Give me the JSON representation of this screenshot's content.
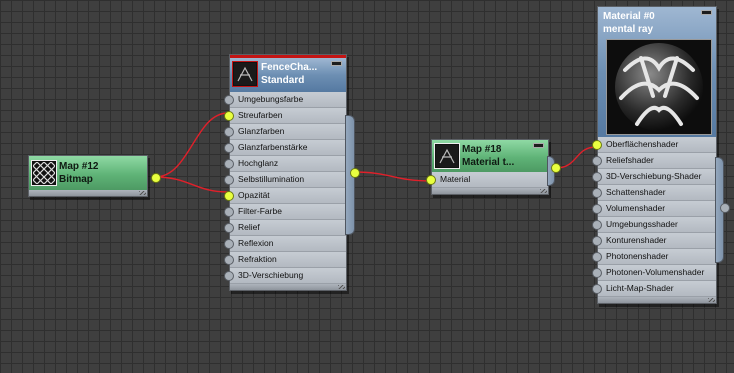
{
  "nodes": {
    "bitmap": {
      "line1": "Map #12",
      "line2": "Bitmap",
      "icon": "chainlink-fence-thumbnail"
    },
    "fence": {
      "line1": "FenceCha...",
      "line2": "Standard",
      "icon": "fence-material-thumbnail",
      "slots": [
        {
          "label": "Umgebungsfarbe",
          "connected": false
        },
        {
          "label": "Streufarben",
          "connected": true
        },
        {
          "label": "Glanzfarben",
          "connected": false
        },
        {
          "label": "Glanzfarbenstärke",
          "connected": false
        },
        {
          "label": "Hochglanz",
          "connected": false
        },
        {
          "label": "Selbstillumination",
          "connected": false
        },
        {
          "label": "Opazität",
          "connected": true
        },
        {
          "label": "Filter-Farbe",
          "connected": false
        },
        {
          "label": "Relief",
          "connected": false
        },
        {
          "label": "Reflexion",
          "connected": false
        },
        {
          "label": "Refraktion",
          "connected": false
        },
        {
          "label": "3D-Verschiebung",
          "connected": false
        }
      ]
    },
    "map18": {
      "line1": "Map #18",
      "line2": "Material t...",
      "icon": "material-to-shader-thumbnail",
      "slots": [
        {
          "label": "Material",
          "connected": true
        }
      ]
    },
    "material0": {
      "line1": "Material #0",
      "line2": "mental ray",
      "icon": "sphere-preview-thumbnail",
      "slots": [
        {
          "label": "Oberflächenshader",
          "connected": true
        },
        {
          "label": "Reliefshader",
          "connected": false
        },
        {
          "label": "3D-Verschiebung-Shader",
          "connected": false
        },
        {
          "label": "Schattenshader",
          "connected": false
        },
        {
          "label": "Volumenshader",
          "connected": false
        },
        {
          "label": "Umgebungsshader",
          "connected": false
        },
        {
          "label": "Konturenshader",
          "connected": false
        },
        {
          "label": "Photonenshader",
          "connected": false
        },
        {
          "label": "Photonen-Volumenshader",
          "connected": false
        },
        {
          "label": "Licht-Map-Shader",
          "connected": false
        }
      ]
    }
  },
  "colors": {
    "wire": "#e0202a",
    "socket_active": "#e9ff40",
    "map_header": "#5fb377",
    "material_header": "#6d8fb3"
  }
}
